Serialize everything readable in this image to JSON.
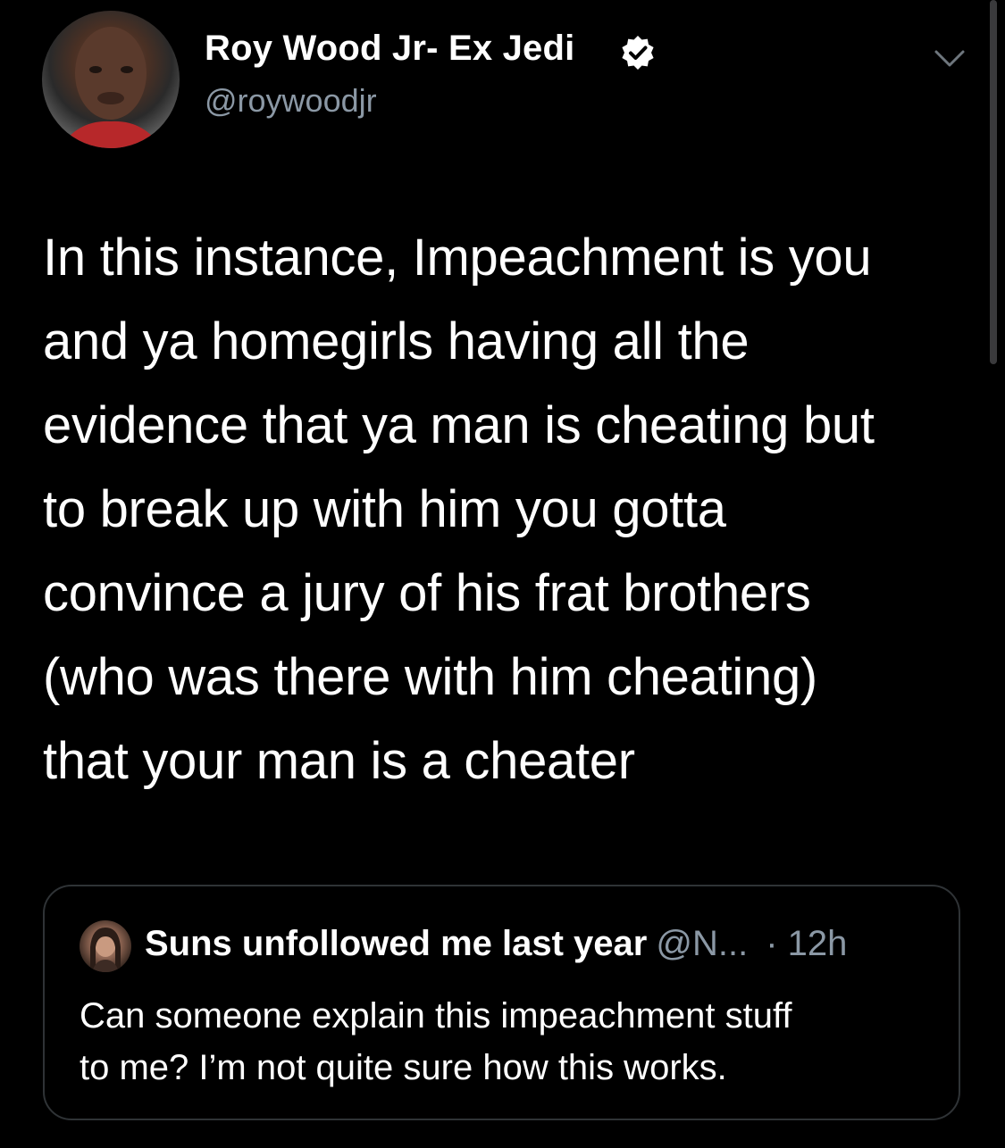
{
  "author": {
    "display_name": "Roy Wood Jr- Ex Jedi",
    "handle": "@roywoodjr",
    "verified": true,
    "avatar": "profile-photo"
  },
  "tweet": {
    "lines": [
      "In this instance, Impeachment is you",
      "and ya homegirls having all the",
      "evidence that ya man is cheating but",
      "to break up with him you gotta",
      "convince a jury of his frat brothers",
      "(who was there with him cheating)",
      "that your man is a cheater"
    ]
  },
  "quoted_tweet": {
    "display_name": "Suns unfollowed me last year",
    "handle": "@N...",
    "time": "· 12h",
    "lines": [
      "Can someone explain this impeachment stuff",
      "to me? I’m not quite sure how this works."
    ]
  },
  "icons": {
    "verified": "verified-badge-icon",
    "menu": "chevron-down-icon"
  },
  "colors": {
    "background": "#000000",
    "text": "#ffffff",
    "secondary_text": "#8b98a5",
    "card_border": "#2f3336"
  }
}
